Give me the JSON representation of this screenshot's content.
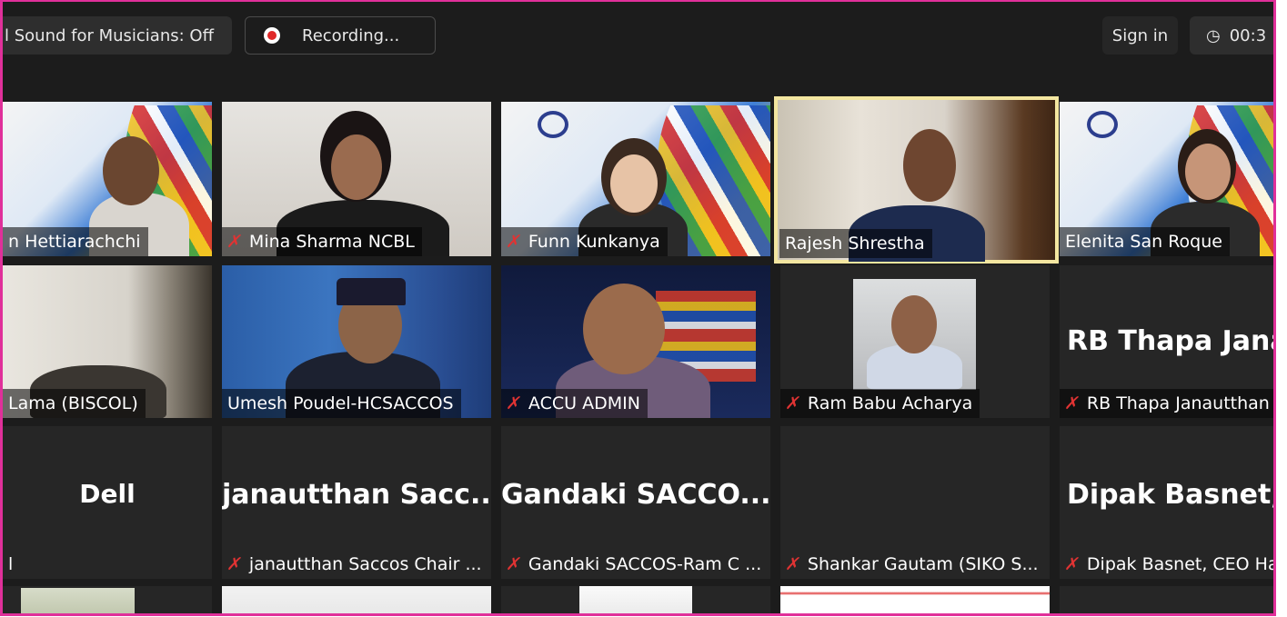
{
  "topbar": {
    "sound_label": "l Sound for Musicians: Off",
    "recording_label": "Recording...",
    "sign_in_label": "Sign in",
    "timer_text": "00:3"
  },
  "row1": [
    {
      "name": "n Hettiarachchi",
      "muted": false
    },
    {
      "name": "Mina Sharma NCBL",
      "muted": true
    },
    {
      "name": "Funn Kunkanya",
      "muted": true
    },
    {
      "name": "Rajesh Shrestha",
      "muted": false,
      "active": true
    },
    {
      "name": "Elenita San Roque",
      "muted": false
    }
  ],
  "row2": [
    {
      "name": "Lama (BISCOL)",
      "muted": false
    },
    {
      "name": "Umesh Poudel-HCSACCOS",
      "muted": false
    },
    {
      "name": "ACCU ADMIN",
      "muted": true
    },
    {
      "name": "Ram Babu Acharya",
      "muted": true
    },
    {
      "name": "RB Thapa Janautthan",
      "muted": true,
      "display_name": "RB  Thapa  Jana"
    }
  ],
  "row3": [
    {
      "name": "l",
      "display_name": "Dell",
      "muted": false
    },
    {
      "name": "janautthan Saccos Chair ...",
      "display_name": "janautthan  Sacc...",
      "muted": true
    },
    {
      "name": "Gandaki SACCOS-Ram C ...",
      "display_name": "Gandaki  SACCO...",
      "muted": true
    },
    {
      "name": "Shankar Gautam (SIKO S...",
      "display_name": "",
      "muted": true
    },
    {
      "name": "Dipak Basnet, CEO Ha",
      "display_name": "Dipak  Basnet,",
      "muted": true
    }
  ],
  "colors": {
    "accent_border": "#e0309a",
    "active_speaker": "#f3e6a0",
    "muted_icon": "#e03333",
    "recording_dot": "#e02828"
  },
  "icons": {
    "muted": "mic-off-icon",
    "recording": "record-icon",
    "timer": "clock-icon"
  }
}
